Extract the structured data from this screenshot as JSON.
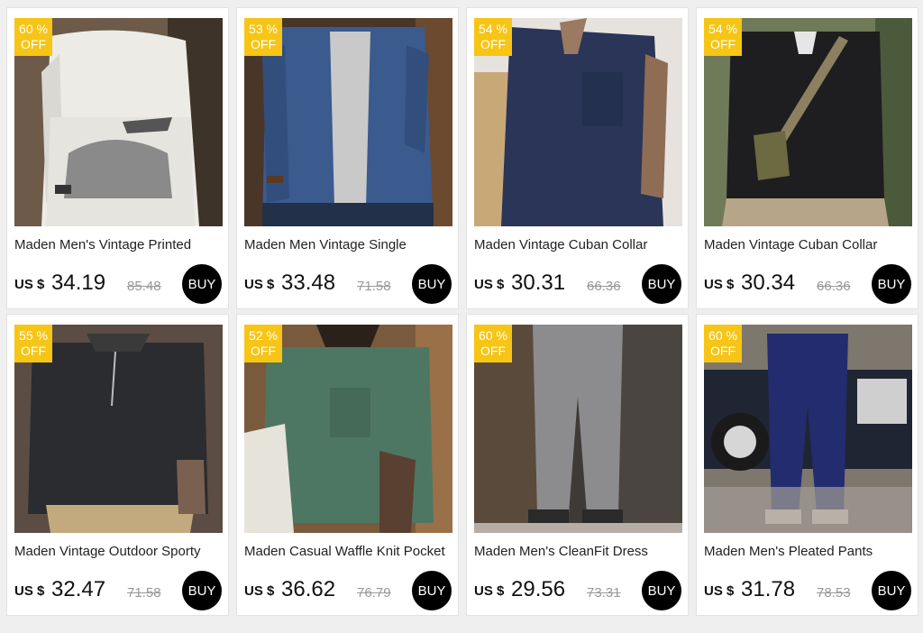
{
  "products": [
    {
      "discount_pct": "60 %",
      "discount_off": "OFF",
      "title": "Maden Men's Vintage Printed",
      "currency": "US $",
      "price": "34.19",
      "old_price": "85.48",
      "buy": "BUY"
    },
    {
      "discount_pct": "53 %",
      "discount_off": "OFF",
      "title": "Maden Men Vintage Single",
      "currency": "US $",
      "price": "33.48",
      "old_price": "71.58",
      "buy": "BUY"
    },
    {
      "discount_pct": "54 %",
      "discount_off": "OFF",
      "title": "Maden Vintage Cuban Collar",
      "currency": "US $",
      "price": "30.31",
      "old_price": "66.36",
      "buy": "BUY"
    },
    {
      "discount_pct": "54 %",
      "discount_off": "OFF",
      "title": "Maden Vintage Cuban Collar",
      "currency": "US $",
      "price": "30.34",
      "old_price": "66.36",
      "buy": "BUY"
    },
    {
      "discount_pct": "55 %",
      "discount_off": "OFF",
      "title": "Maden Vintage Outdoor Sporty",
      "currency": "US $",
      "price": "32.47",
      "old_price": "71.58",
      "buy": "BUY"
    },
    {
      "discount_pct": "52 %",
      "discount_off": "OFF",
      "title": "Maden Casual Waffle Knit Pocket",
      "currency": "US $",
      "price": "36.62",
      "old_price": "76.79",
      "buy": "BUY"
    },
    {
      "discount_pct": "60 %",
      "discount_off": "OFF",
      "title": "Maden Men's CleanFit Dress",
      "currency": "US $",
      "price": "29.56",
      "old_price": "73.31",
      "buy": "BUY"
    },
    {
      "discount_pct": "60 %",
      "discount_off": "OFF",
      "title": "Maden Men's Pleated Pants",
      "currency": "US $",
      "price": "31.78",
      "old_price": "78.53",
      "buy": "BUY"
    }
  ]
}
